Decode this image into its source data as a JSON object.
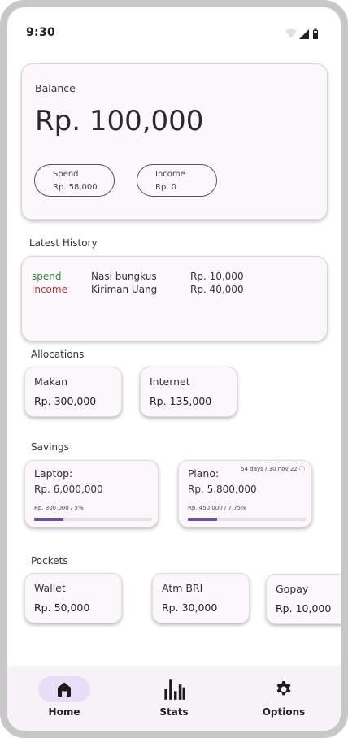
{
  "status_bar": {
    "time": "9:30"
  },
  "balance": {
    "label": "Balance",
    "amount": "Rp. 100,000",
    "spend": {
      "title": "Spend",
      "value": "Rp. 58,000"
    },
    "income": {
      "title": "Income",
      "value": "Rp. 0"
    }
  },
  "history": {
    "title": "Latest History",
    "rows": [
      {
        "type": "spend",
        "name": "Nasi bungkus",
        "amount": "Rp. 10,000",
        "color": "#2e8b3e"
      },
      {
        "type": "income",
        "name": "Kiriman Uang",
        "amount": "Rp. 40,000",
        "color": "#b23a2a"
      }
    ]
  },
  "allocations": {
    "title": "Allocations",
    "items": [
      {
        "name": "Makan",
        "value": "Rp. 300,000"
      },
      {
        "name": "Internet",
        "value": "Rp. 135,000"
      }
    ]
  },
  "savings": {
    "title": "Savings",
    "items": [
      {
        "name": "Laptop:",
        "amount": "Rp. 6,000,000",
        "progress_label": "Rp. 300,000 / 5%",
        "progress": 0.25,
        "deadline": ""
      },
      {
        "name": "Piano:",
        "amount": "Rp. 5.800,000",
        "progress_label": "Rp. 450,000 / 7.75%",
        "progress": 0.25,
        "deadline": "54 days / 30 nov 22 ⓘ"
      }
    ]
  },
  "pockets": {
    "title": "Pockets",
    "items": [
      {
        "name": "Wallet",
        "value": "Rp. 50,000"
      },
      {
        "name": "Atm BRI",
        "value": "Rp. 30,000"
      },
      {
        "name": "Gopay",
        "value": "Rp. 10,000"
      }
    ]
  },
  "nav": {
    "items": [
      {
        "label": "Home",
        "icon": "home-icon",
        "active": true
      },
      {
        "label": "Stats",
        "icon": "stats-icon",
        "active": false
      },
      {
        "label": "Options",
        "icon": "gear-icon",
        "active": false
      }
    ]
  },
  "colors": {
    "accent": "#6b4fa0",
    "card_bg": "#fcf7fb",
    "nav_active": "#e8def8"
  }
}
